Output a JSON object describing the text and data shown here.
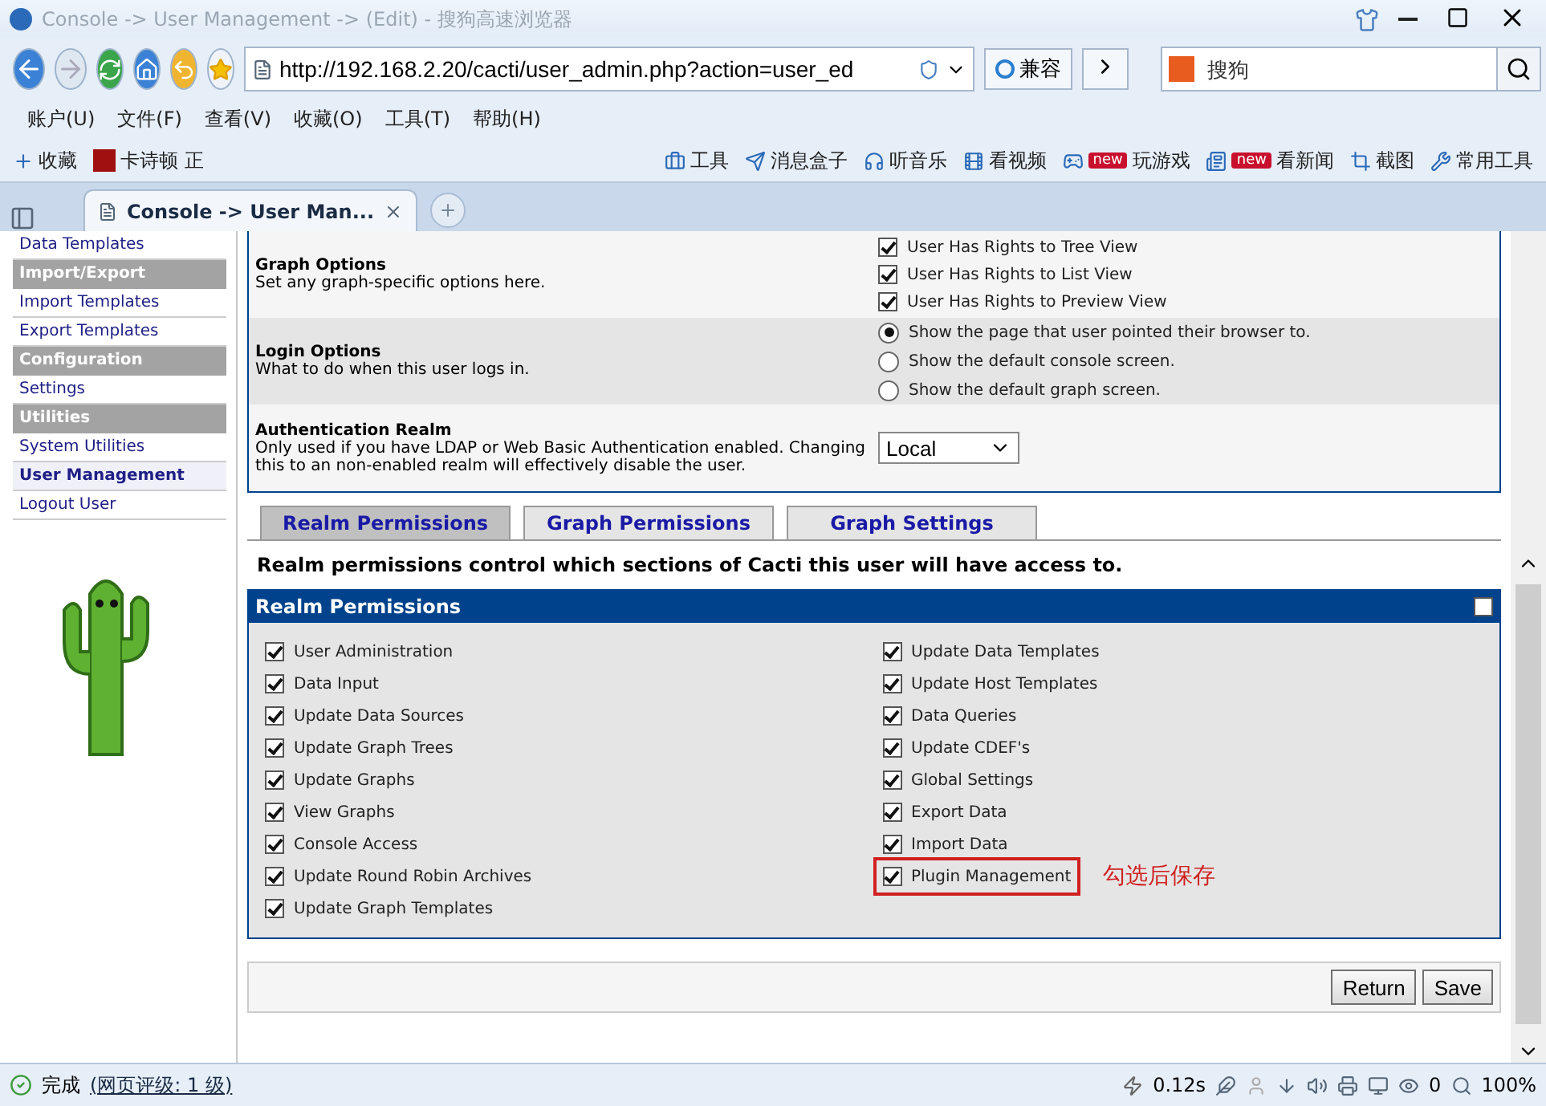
{
  "window": {
    "title": "Console -> User Management -> (Edit) - 搜狗高速浏览器"
  },
  "nav": {
    "url": "http://192.168.2.20/cacti/user_admin.php?action=user_ed",
    "compat_label": "兼容",
    "search": {
      "placeholder": "搜狗"
    }
  },
  "menu": [
    "账户(U)",
    "文件(F)",
    "查看(V)",
    "收藏(O)",
    "工具(T)",
    "帮助(H)"
  ],
  "favorites": {
    "left": [
      {
        "label": "收藏",
        "kind": "star"
      },
      {
        "label": "卡诗顿 正",
        "kind": "t"
      }
    ],
    "right": [
      {
        "label": "工具",
        "kind": "tools"
      },
      {
        "label": "消息盒子",
        "kind": "msg"
      },
      {
        "label": "听音乐",
        "kind": "music"
      },
      {
        "label": "看视频",
        "kind": "video"
      },
      {
        "label": "玩游戏",
        "kind": "game",
        "badge": "new"
      },
      {
        "label": "看新闻",
        "kind": "news",
        "badge": "new"
      },
      {
        "label": "截图",
        "kind": "shot"
      },
      {
        "label": "常用工具",
        "kind": "wrench"
      }
    ]
  },
  "tabs": [
    {
      "label": "Console -> User Man...",
      "selected": true
    }
  ],
  "sidebar": {
    "items": [
      {
        "label": "Data Templates",
        "kind": "link",
        "selected": false
      },
      {
        "label": "Import/Export",
        "kind": "header"
      },
      {
        "label": "Import Templates",
        "kind": "link",
        "selected": false
      },
      {
        "label": "Export Templates",
        "kind": "link",
        "selected": false
      },
      {
        "label": "Configuration",
        "kind": "header"
      },
      {
        "label": "Settings",
        "kind": "link",
        "selected": false
      },
      {
        "label": "Utilities",
        "kind": "header"
      },
      {
        "label": "System Utilities",
        "kind": "link",
        "selected": false
      },
      {
        "label": "User Management",
        "kind": "link",
        "selected": true
      },
      {
        "label": "Logout User",
        "kind": "link",
        "selected": false
      }
    ]
  },
  "form": [
    {
      "title": "Graph Options",
      "description": "Set any graph-specific options here.",
      "kind": "checkboxes",
      "options": [
        {
          "label": "User Has Rights to Tree View",
          "checked": true
        },
        {
          "label": "User Has Rights to List View",
          "checked": true
        },
        {
          "label": "User Has Rights to Preview View",
          "checked": true
        }
      ]
    },
    {
      "title": "Login Options",
      "description": "What to do when this user logs in.",
      "kind": "radios",
      "options": [
        {
          "label": "Show the page that user pointed their browser to.",
          "selected": true
        },
        {
          "label": "Show the default console screen.",
          "selected": false
        },
        {
          "label": "Show the default graph screen.",
          "selected": false
        }
      ]
    },
    {
      "title": "Authentication Realm",
      "description": "Only used if you have LDAP or Web Basic Authentication enabled. Changing this to an non-enabled realm will effectively disable the user.",
      "kind": "select",
      "value": "Local"
    }
  ],
  "permission_tabs": [
    {
      "label": "Realm Permissions",
      "selected": true
    },
    {
      "label": "Graph Permissions",
      "selected": false
    },
    {
      "label": "Graph Settings",
      "selected": false
    }
  ],
  "intro": "Realm permissions control which sections of Cacti this user will have access to.",
  "panel": {
    "title": "Realm Permissions",
    "select_all_checked": false,
    "columns": [
      [
        {
          "label": "User Administration",
          "checked": true
        },
        {
          "label": "Data Input",
          "checked": true
        },
        {
          "label": "Update Data Sources",
          "checked": true
        },
        {
          "label": "Update Graph Trees",
          "checked": true
        },
        {
          "label": "Update Graphs",
          "checked": true
        },
        {
          "label": "View Graphs",
          "checked": true
        },
        {
          "label": "Console Access",
          "checked": true
        },
        {
          "label": "Update Round Robin Archives",
          "checked": true
        },
        {
          "label": "Update Graph Templates",
          "checked": true
        }
      ],
      [
        {
          "label": "Update Data Templates",
          "checked": true
        },
        {
          "label": "Update Host Templates",
          "checked": true
        },
        {
          "label": "Data Queries",
          "checked": true
        },
        {
          "label": "Update CDEF's",
          "checked": true
        },
        {
          "label": "Global Settings",
          "checked": true
        },
        {
          "label": "Export Data",
          "checked": true
        },
        {
          "label": "Import Data",
          "checked": true
        },
        {
          "label": "Plugin Management",
          "checked": true,
          "highlighted": true,
          "note": "勾选后保存"
        }
      ]
    ]
  },
  "buttons": [
    "Return",
    "Save"
  ],
  "status": {
    "text": "完成",
    "link": "(网页评级: 1 级)",
    "timing": "0.12s",
    "count": "0",
    "zoom": "100%"
  }
}
